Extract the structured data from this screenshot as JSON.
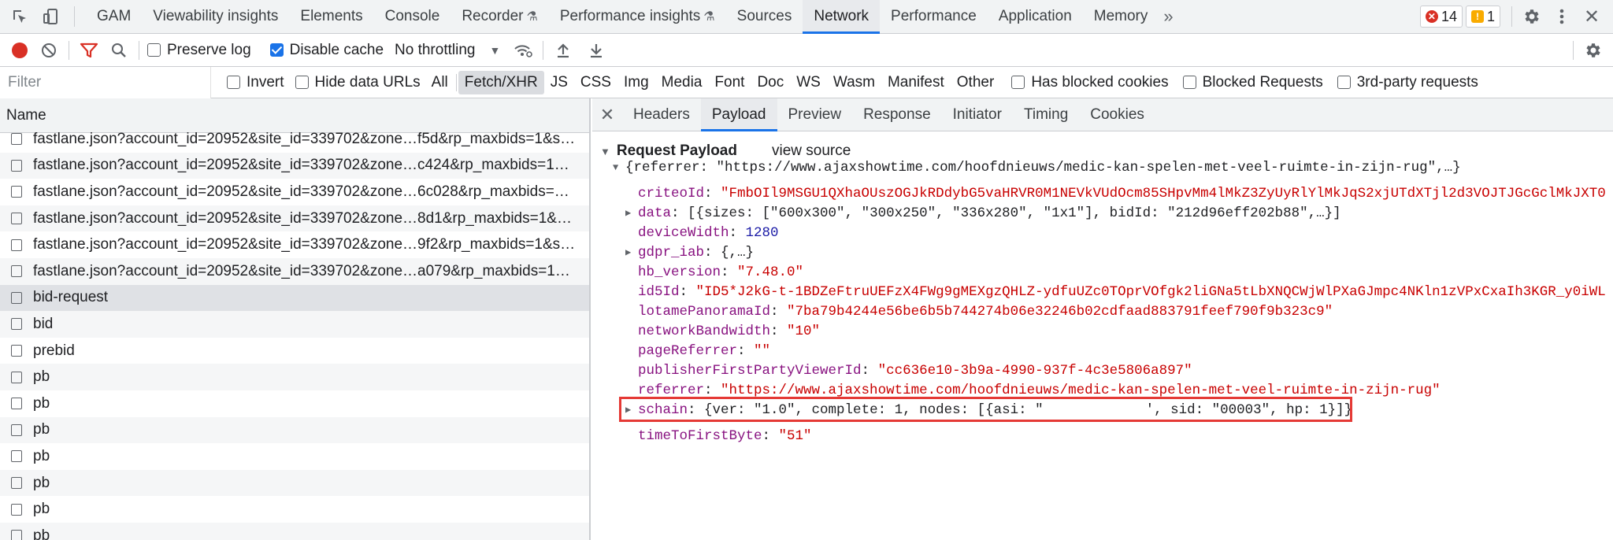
{
  "tabbar": {
    "tabs": [
      "GAM",
      "Viewability insights",
      "Elements",
      "Console",
      "Recorder",
      "Performance insights",
      "Sources",
      "Network",
      "Performance",
      "Application",
      "Memory"
    ],
    "active": "Network",
    "errors": "14",
    "warnings": "1"
  },
  "toolbar": {
    "preserve_log": "Preserve log",
    "disable_cache": "Disable cache",
    "throttling": "No throttling"
  },
  "filter": {
    "placeholder": "Filter",
    "invert": "Invert",
    "hide_data_urls": "Hide data URLs",
    "types": [
      "All",
      "Fetch/XHR",
      "JS",
      "CSS",
      "Img",
      "Media",
      "Font",
      "Doc",
      "WS",
      "Wasm",
      "Manifest",
      "Other"
    ],
    "active_type": "Fetch/XHR",
    "blocked_cookies": "Has blocked cookies",
    "blocked_requests": "Blocked Requests",
    "third_party": "3rd-party requests"
  },
  "requests": {
    "header": "Name",
    "items": [
      "fastlane.json?account_id=20952&site_id=339702&zone…f5d&rp_maxbids=1&s…",
      "fastlane.json?account_id=20952&site_id=339702&zone…c424&rp_maxbids=1…",
      "fastlane.json?account_id=20952&site_id=339702&zone…6c028&rp_maxbids=…",
      "fastlane.json?account_id=20952&site_id=339702&zone…8d1&rp_maxbids=1&…",
      "fastlane.json?account_id=20952&site_id=339702&zone…9f2&rp_maxbids=1&s…",
      "fastlane.json?account_id=20952&site_id=339702&zone…a079&rp_maxbids=1…",
      "bid-request",
      "bid",
      "prebid",
      "pb",
      "pb",
      "pb",
      "pb",
      "pb",
      "pb",
      "pb"
    ],
    "selected_index": 6
  },
  "details": {
    "tabs": [
      "Headers",
      "Payload",
      "Preview",
      "Response",
      "Initiator",
      "Timing",
      "Cookies"
    ],
    "active": "Payload",
    "section_title": "Request Payload",
    "view_source": "view source",
    "root": "{referrer: \"https://www.ajaxshowtime.com/hoofdnieuws/medic-kan-spelen-met-veel-ruimte-in-zijn-rug\",…}",
    "fields": [
      {
        "key": "criteoId",
        "value": "\"FmbOIl9MSGU1QXhaOUszOGJkRDdybG5vaHRVR0M1NEVkVUdOcm85SHpvMm4lMkZ3ZyUyRlYlMkJqS2xjUTdXTjl2d3VOJTJGcGclMkJXT0",
        "type": "str",
        "expand": false
      },
      {
        "key": "data",
        "value": "[{sizes: [\"600x300\", \"300x250\", \"336x280\", \"1x1\"], bidId: \"212d96eff202b88\",…}]",
        "type": "tok",
        "expand": true
      },
      {
        "key": "deviceWidth",
        "value": "1280",
        "type": "num",
        "expand": false
      },
      {
        "key": "gdpr_iab",
        "value": "{,…}",
        "type": "tok",
        "expand": true
      },
      {
        "key": "hb_version",
        "value": "\"7.48.0\"",
        "type": "str",
        "expand": false
      },
      {
        "key": "id5Id",
        "value": "\"ID5*J2kG-t-1BDZeFtruUEFzX4FWg9gMEXgzQHLZ-ydfuUZc0TOprVOfgk2liGNa5tLbXNQCWjWlPXaGJmpc4NKln1zVPxCxaIh3KGR_y0iWL",
        "type": "str",
        "expand": false
      },
      {
        "key": "lotamePanoramaId",
        "value": "\"7ba79b4244e56be6b5b744274b06e32246b02cdfaad883791feef790f9b323c9\"",
        "type": "str",
        "expand": false
      },
      {
        "key": "networkBandwidth",
        "value": "\"10\"",
        "type": "str",
        "expand": false
      },
      {
        "key": "pageReferrer",
        "value": "\"\"",
        "type": "str",
        "expand": false
      },
      {
        "key": "publisherFirstPartyViewerId",
        "value": "\"cc636e10-3b9a-4990-937f-4c3e5806a897\"",
        "type": "str",
        "expand": false
      },
      {
        "key": "referrer",
        "value": "\"https://www.ajaxshowtime.com/hoofdnieuws/medic-kan-spelen-met-veel-ruimte-in-zijn-rug\"",
        "type": "str",
        "expand": false
      }
    ],
    "schain": {
      "key": "schain",
      "prefix": "{ver: \"1.0\", complete: 1, nodes: [{asi: \"",
      "suffix": "', sid: \"00003\", hp: 1}]}"
    },
    "last_field": {
      "key": "timeToFirstByte",
      "value": "\"51\""
    }
  }
}
